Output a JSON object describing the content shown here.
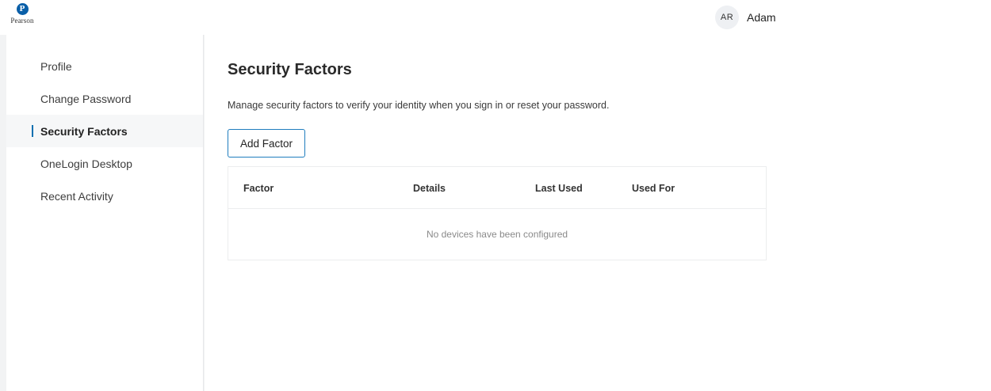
{
  "brand": {
    "logo_letter": "P",
    "logo_text": "Pearson"
  },
  "user": {
    "initials": "AR",
    "name": "Adam"
  },
  "sidebar": {
    "items": [
      {
        "label": "Profile",
        "active": false
      },
      {
        "label": "Change Password",
        "active": false
      },
      {
        "label": "Security Factors",
        "active": true
      },
      {
        "label": "OneLogin Desktop",
        "active": false
      },
      {
        "label": "Recent Activity",
        "active": false
      }
    ]
  },
  "main": {
    "title": "Security Factors",
    "description": "Manage security factors to verify your identity when you sign in or reset your password.",
    "add_button_label": "Add Factor",
    "table": {
      "columns": [
        "Factor",
        "Details",
        "Last Used",
        "Used For"
      ],
      "empty_message": "No devices have been configured"
    }
  },
  "colors": {
    "accent": "#0a6fb0",
    "brand": "#0a5fa8",
    "background": "#f2f3f4"
  }
}
